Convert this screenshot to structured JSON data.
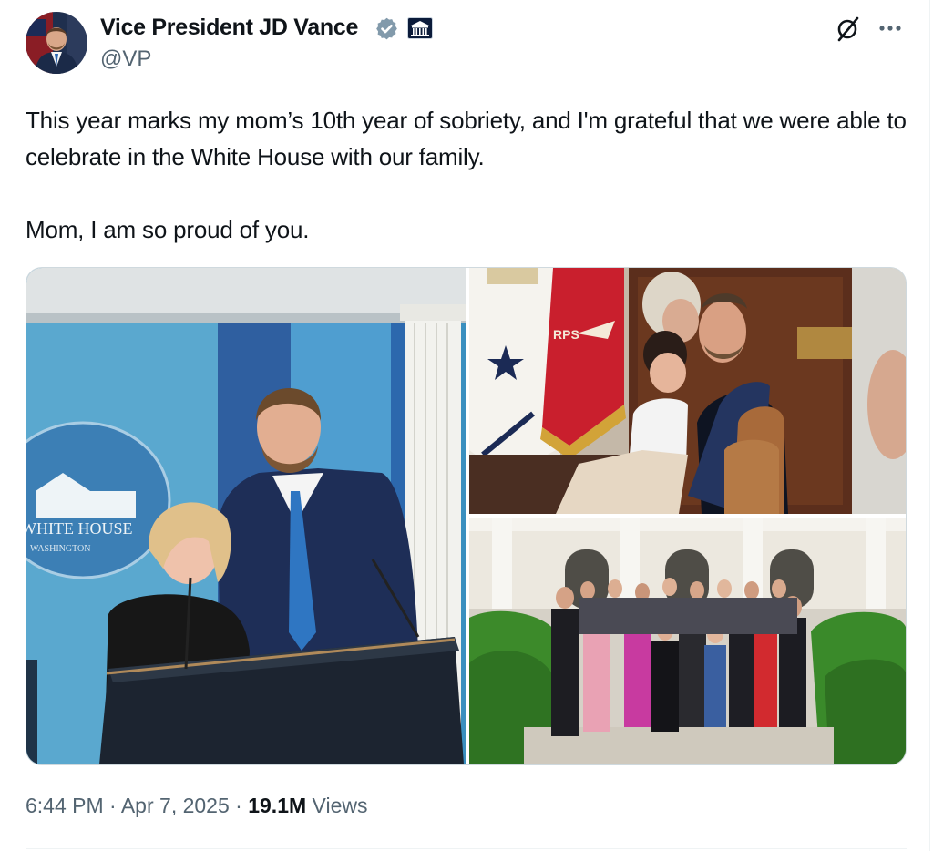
{
  "post": {
    "author": {
      "name": "Vice President JD Vance",
      "handle": "@VP",
      "verified_icon": "verified-badge-icon",
      "affiliation_icon": "white-house-affiliation-icon"
    },
    "actions": {
      "grok_icon": "grok-icon",
      "more_icon": "more-options-icon"
    },
    "text_lines": [
      "This year marks my mom’s 10th year of sobriety, and I'm grateful that we were able to celebrate in the White House with our family.",
      "Mom, I am so proud of you."
    ],
    "media": {
      "photo1_sign_line1": "WHITE HOUSE",
      "photo1_sign_line2": "WASHINGTON",
      "photo2_flag_text": "RPS"
    },
    "time": "6:44 PM",
    "separator": "·",
    "date": "Apr 7, 2025",
    "views_count": "19.1M",
    "views_label": "Views"
  },
  "colors": {
    "text_primary": "#0f1419",
    "text_secondary": "#536471",
    "verified_blue": "#829aab",
    "border": "#cfd9de"
  }
}
